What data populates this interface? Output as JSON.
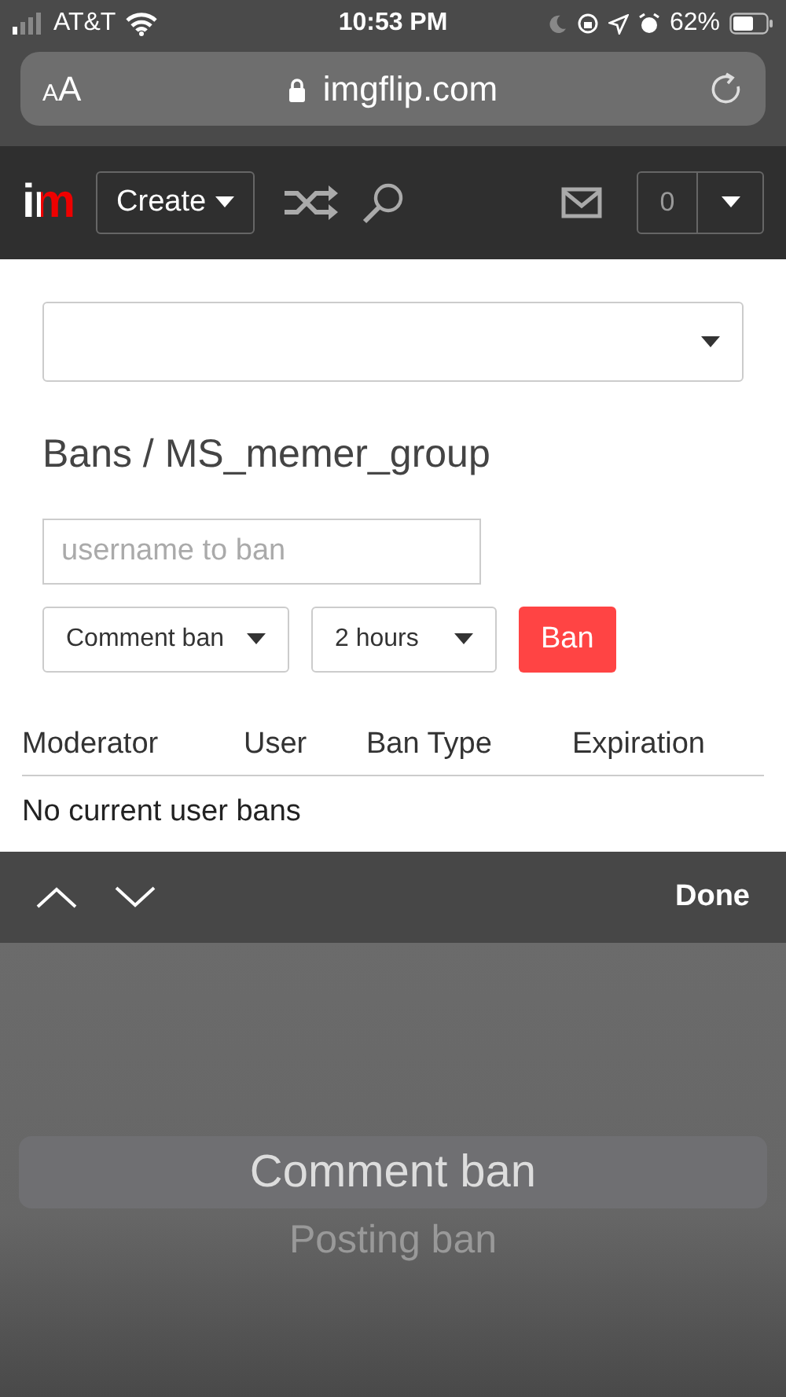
{
  "status_bar": {
    "carrier": "AT&T",
    "time": "10:53 PM",
    "battery": "62%"
  },
  "address_bar": {
    "text_size": "AA",
    "url": "imgflip.com"
  },
  "nav": {
    "logo": "im",
    "create_button": "Create",
    "notification_count": "0"
  },
  "title": "Bans / MS_memer_group",
  "ban_form": {
    "username": {
      "placeholder": "username to ban"
    },
    "ban_type": "Comment ban",
    "duration": "2 hours",
    "submit": "Ban"
  },
  "table": {
    "columns": [
      "Moderator",
      "User",
      "Ban Type",
      "Expiration"
    ],
    "empty_message": "No current user bans"
  },
  "keyboard_bar": {
    "done": "Done"
  },
  "picker": {
    "options": [
      {
        "label": "Comment ban",
        "selected": true
      },
      {
        "label": "Posting ban",
        "selected": false
      }
    ]
  }
}
